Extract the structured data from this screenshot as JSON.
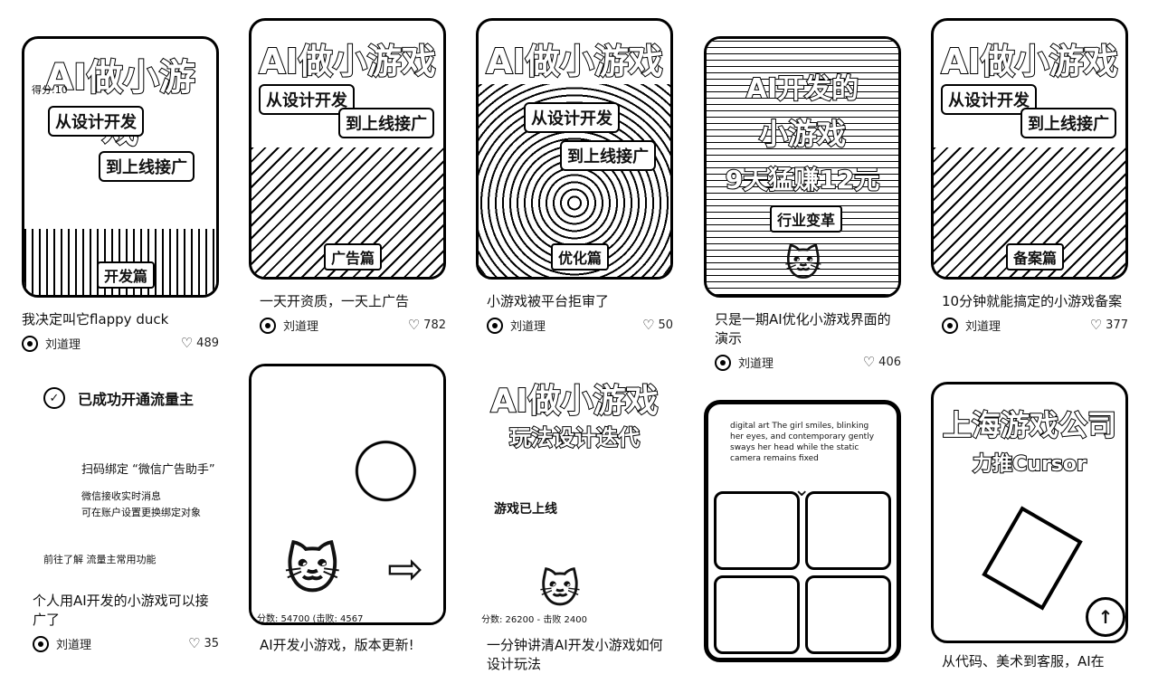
{
  "cards": [
    {
      "thumb_title": "AI做小游戏",
      "thumb_sub1": "从设计开发",
      "thumb_sub2": "到上线接广",
      "thumb_tag": "开发篇",
      "thumb_score": "得分:10",
      "caption": "我决定叫它flappy duck",
      "author": "刘道理",
      "likes": "489"
    },
    {
      "thumb_title": "AI做小游戏",
      "thumb_sub1": "从设计开发",
      "thumb_sub2": "到上线接广",
      "thumb_tag": "广告篇",
      "caption": "一天开资质，一天上广告",
      "author": "刘道理",
      "likes": "782"
    },
    {
      "thumb_title": "AI做小游戏",
      "thumb_sub1": "从设计开发",
      "thumb_sub2": "到上线接广",
      "thumb_tag": "优化篇",
      "caption": "小游戏被平台拒审了",
      "author": "刘道理",
      "likes": "50"
    },
    {
      "thumb_title": "AI开发的",
      "thumb_sub1": "小游戏",
      "thumb_sub2": "9天猛赚12元",
      "thumb_tag": "行业变革",
      "caption": "只是一期AI优化小游戏界面的演示",
      "author": "刘道理",
      "likes": "406"
    },
    {
      "thumb_title": "AI做小游戏",
      "thumb_sub1": "从设计开发",
      "thumb_sub2": "到上线接广",
      "thumb_tag": "备案篇",
      "caption": "10分钟就能搞定的小游戏备案",
      "author": "刘道理",
      "likes": "377"
    },
    {
      "promo_title": "已成功开通流量主",
      "promo_line1": "扫码绑定 “微信广告助手”",
      "promo_line2": "微信接收实时消息",
      "promo_line3": "可在账户设置更换绑定对象",
      "promo_line4": "前往了解 流量主常用功能",
      "caption": "个人用AI开发的小游戏可以接广了",
      "author": "刘道理",
      "likes": "35"
    },
    {
      "thumb_score": "分数: 54700 (击败: 4567",
      "caption": "AI开发小游戏，版本更新!"
    },
    {
      "thumb_title": "AI做小游戏",
      "thumb_sub1": "玩法设计迭代",
      "thumb_note": "游戏已上线",
      "thumb_score": "分数: 26200 - 击败 2400",
      "caption": "一分钟讲清AI开发小游戏如何设计玩法"
    },
    {
      "thumb_text": "digital art  The girl smiles, blinking her eyes, and  contemporary  gently sways her head while the  static  camera remains fixed"
    },
    {
      "thumb_title": "上海游戏公司",
      "thumb_sub1": "力推Cursor",
      "caption": "从代码、美术到客服，AI在"
    }
  ],
  "back_to_top_icon": "arrow-up-icon",
  "colors": {
    "ink": "#000000",
    "paper": "#ffffff"
  }
}
